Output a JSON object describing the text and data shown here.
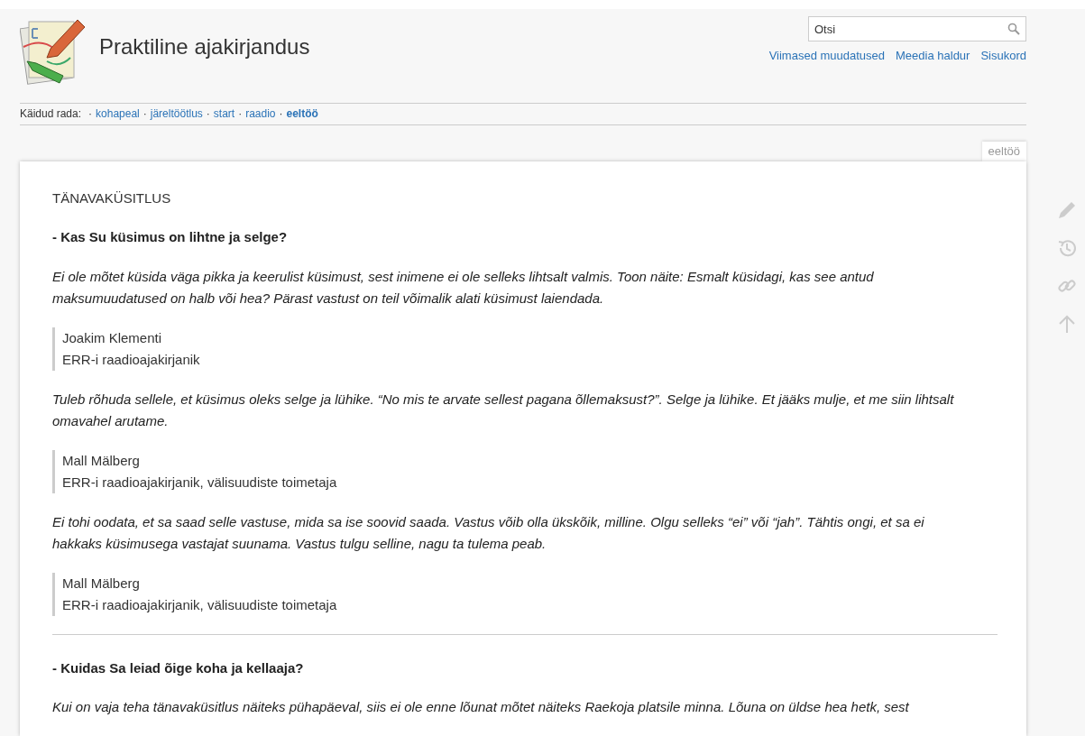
{
  "site": {
    "title": "Praktiline ajakirjandus"
  },
  "search": {
    "placeholder": "Otsi"
  },
  "tools": [
    "Viimased muudatused",
    "Meedia haldur",
    "Sisukord"
  ],
  "breadcrumb": {
    "label": "Käidud rada:",
    "separator": "·",
    "items": [
      {
        "text": "kohapeal",
        "current": false
      },
      {
        "text": "järeltöötlus",
        "current": false
      },
      {
        "text": "start",
        "current": false
      },
      {
        "text": "raadio",
        "current": false
      },
      {
        "text": "eeltöö",
        "current": true
      }
    ]
  },
  "page_tab": "eeltöö",
  "content": [
    {
      "kind": "heading",
      "text": "TÄNAVAKÜSITLUS"
    },
    {
      "kind": "question",
      "text": "- Kas Su küsimus on lihtne ja selge?"
    },
    {
      "kind": "paragraph",
      "text": "Ei ole mõtet küsida väga pikka ja keerulist küsimust, sest inimene ei ole selleks lihtsalt valmis. Toon näite: Esmalt küsidagi, kas see antud maksumuudatused on halb või hea? Pärast vastust on teil võimalik alati küsimust laiendada."
    },
    {
      "kind": "quote",
      "lines": [
        "Joakim Klementi",
        "ERR-i raadioajakirjanik"
      ]
    },
    {
      "kind": "paragraph",
      "text": "Tuleb rõhuda sellele, et küsimus oleks selge ja lühike. “No mis te arvate sellest pagana õllemaksust?”. Selge ja lühike. Et jääks mulje, et me siin lihtsalt omavahel arutame."
    },
    {
      "kind": "quote",
      "lines": [
        "Mall Mälberg",
        "ERR-i raadioajakirjanik, välisuudiste toimetaja"
      ]
    },
    {
      "kind": "paragraph",
      "text": "Ei tohi oodata, et sa saad selle vastuse, mida sa ise soovid saada. Vastus võib olla ükskõik, milline. Olgu selleks “ei” või “jah”. Tähtis ongi, et sa ei hakkaks küsimusega vastajat suunama. Vastus tulgu selline, nagu ta tulema peab."
    },
    {
      "kind": "quote",
      "lines": [
        "Mall Mälberg",
        "ERR-i raadioajakirjanik, välisuudiste toimetaja"
      ]
    },
    {
      "kind": "rule"
    },
    {
      "kind": "question",
      "text": "- Kuidas Sa leiad õige koha ja kellaaja?"
    },
    {
      "kind": "paragraph",
      "text": "Kui on vaja teha tänavaküsitlus näiteks pühapäeval, siis ei ole enne lõunat mõtet näiteks Raekoja platsile minna. Lõuna on üldse hea hetk, sest"
    }
  ]
}
